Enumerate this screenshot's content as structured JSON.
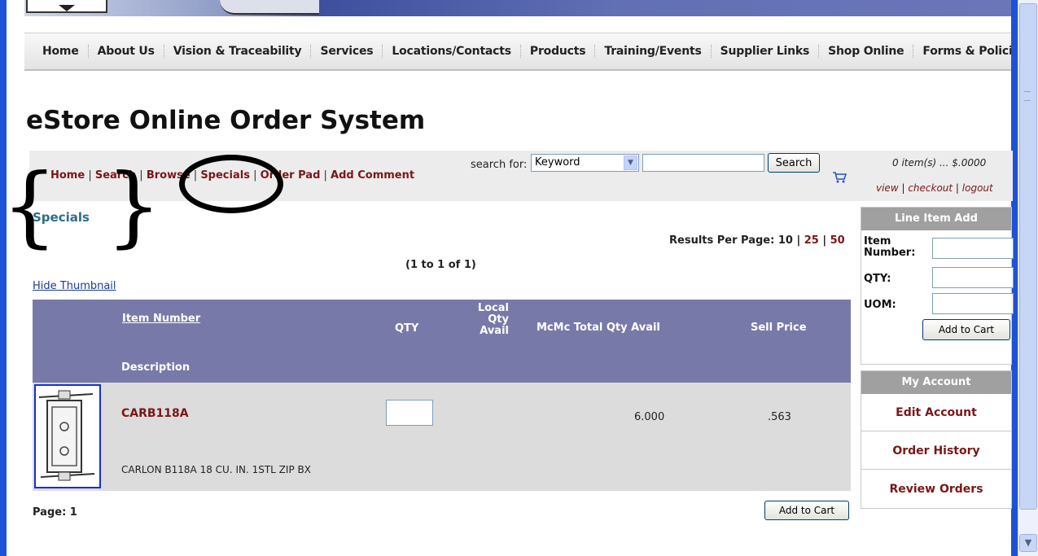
{
  "nav": {
    "items": [
      "Home",
      "About Us",
      "Vision & Traceability",
      "Services",
      "Locations/Contacts",
      "Products",
      "Training/Events",
      "Supplier Links",
      "Shop Online",
      "Forms & Policie"
    ]
  },
  "page": {
    "title": "eStore Online Order System"
  },
  "toolbar": {
    "crumbs": [
      "Home",
      "Search",
      "Browse",
      "Specials",
      "Order Pad",
      "Add Comment"
    ],
    "search_label": "search for:",
    "search_select": "Keyword",
    "search_button": "Search",
    "cart_summary": "0 item(s) ... $.0000",
    "cart_links": [
      "view",
      "checkout",
      "logout"
    ]
  },
  "section": {
    "title": "Specials",
    "results_label": "Results Per Page: 10 |",
    "results_25": "25",
    "results_sep": "|",
    "results_50": "50",
    "count": "(1 to 1 of 1)",
    "hide_thumbnail": "Hide Thumbnail"
  },
  "table": {
    "headers": {
      "item_number": "Item Number",
      "qty": "QTY",
      "local_qty_avail_1": "Local",
      "local_qty_avail_2": "Qty",
      "local_qty_avail_3": "Avail",
      "total_qty": "McMc Total Qty Avail",
      "sell_price": "Sell Price",
      "description": "Description"
    },
    "rows": [
      {
        "item_number": "CARB118A",
        "total_qty": "6.000",
        "sell_price": ".563",
        "description": "CARLON B118A 18 CU. IN. 1STL ZIP BX"
      }
    ],
    "page_label": "Page: 1",
    "add_to_cart": "Add to Cart"
  },
  "side": {
    "line_item_add": "Line Item Add",
    "item_number_1": "Item",
    "item_number_2": "Number:",
    "qty": "QTY:",
    "uom": "UOM:",
    "add_to_cart": "Add to Cart",
    "my_account": "My Account",
    "account_links": [
      "Edit Account",
      "Order History",
      "Review Orders"
    ]
  },
  "colors": {
    "link_maroon": "#7a1717",
    "table_header": "#777aa8",
    "section_title": "#2a6d8f",
    "window_border": "#1c52d6"
  }
}
